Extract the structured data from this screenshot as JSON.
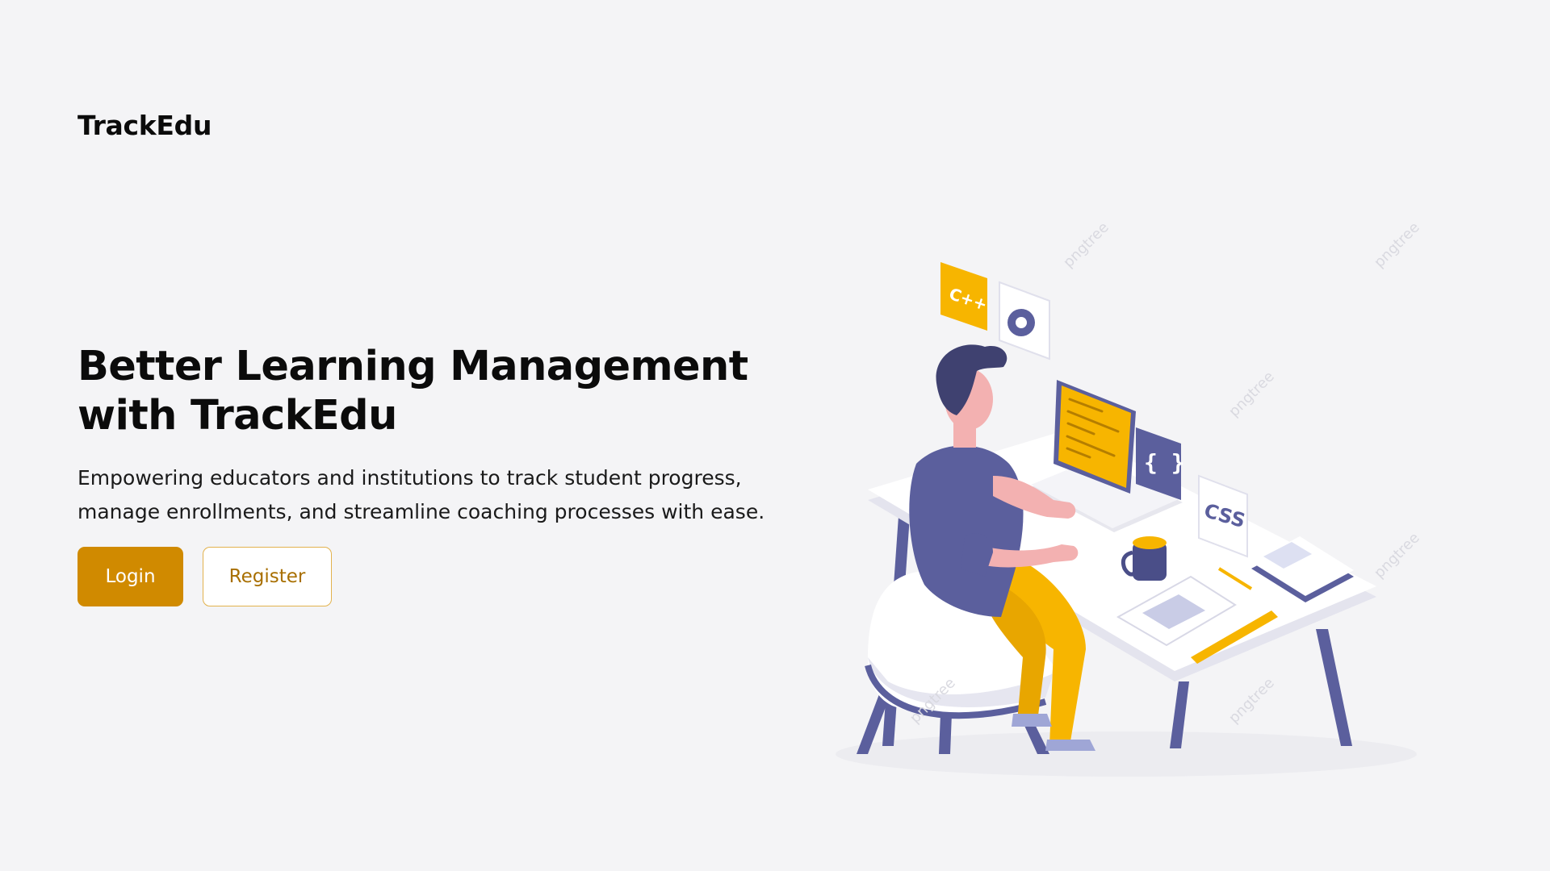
{
  "header": {
    "brand": "TrackEdu"
  },
  "hero": {
    "title_line1": "Better Learning Management",
    "title_line2": "with TrackEdu",
    "description_line1": "Empowering educators and institutions to track student progress,",
    "description_line2": "manage enrollments, and streamline coaching processes with ease."
  },
  "actions": {
    "login_label": "Login",
    "register_label": "Register"
  },
  "illustration": {
    "cpp_tag": "C++",
    "css_tag": "CSS",
    "braces_tag": "{ }",
    "watermark": "pngtree"
  },
  "colors": {
    "background": "#f4f4f6",
    "accent": "#d08a00",
    "accent_border": "#e2b24e",
    "illustration_purple": "#5b5f9d",
    "illustration_yellow": "#f7b500"
  }
}
